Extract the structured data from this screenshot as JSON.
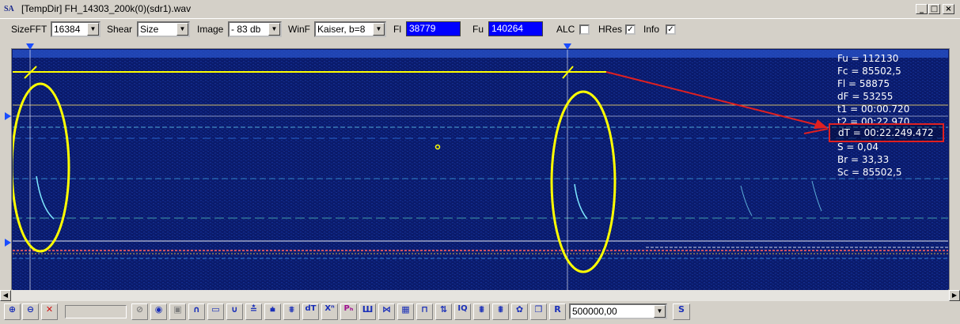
{
  "window": {
    "icon_text": "SA",
    "title": "[TempDir] FH_14303_200k(0)(sdr1).wav",
    "minimize": "_",
    "maximize": "□",
    "close": "×"
  },
  "toolbar": {
    "sizefft_label": "SizeFFT",
    "sizefft_value": "16384",
    "shear_label": "Shear",
    "shear_value": "Size",
    "image_label": "Image",
    "image_value": "- 83 db",
    "winf_label": "WinF",
    "winf_value": "Kaiser, b=8",
    "fl_label": "Fl",
    "fl_value": "38779",
    "fu_label": "Fu",
    "fu_value": "140264",
    "alc_label": "ALC",
    "alc_checked": false,
    "hres_label": "HRes",
    "hres_checked": true,
    "info_label": "Info",
    "info_checked": true
  },
  "info_overlay": {
    "lines": [
      "Fu = 112130",
      "Fc = 85502,5",
      "Fl = 58875",
      "dF = 53255",
      "t1 = 00:00.720",
      "t2 = 00:22.970"
    ],
    "dt": "dT = 00:22.249.472",
    "lines_after": [
      "S = 0,04",
      "Br = 33,33",
      "Sc = 85502,5"
    ]
  },
  "annotation_colors": {
    "cursor_line": "#ffff00",
    "ellipse": "#ffff00",
    "arrow": "#e02020",
    "highlight_box": "#e02020"
  },
  "bottom_toolbar": {
    "buttons": [
      {
        "name": "zoom-in-icon",
        "glyph": "🔍"
      },
      {
        "name": "zoom-out-icon",
        "glyph": "🔍"
      },
      {
        "name": "close-x-icon",
        "glyph": "✕"
      },
      {
        "name": "disabled-icon",
        "glyph": "⊘"
      },
      {
        "name": "speaker-icon",
        "glyph": "◉"
      },
      {
        "name": "square-icon",
        "glyph": "▣"
      },
      {
        "name": "arc-up-icon",
        "glyph": "∩"
      },
      {
        "name": "rectangle-icon",
        "glyph": "▭"
      },
      {
        "name": "arc-down-icon",
        "glyph": "∪"
      },
      {
        "name": "tree-icon",
        "glyph": "≛"
      },
      {
        "name": "marker-down-icon",
        "glyph": "⩧"
      },
      {
        "name": "double-marker-icon",
        "glyph": "⩨"
      },
      {
        "name": "dt-icon",
        "glyph": "dT"
      },
      {
        "name": "xn-icon",
        "glyph": "Xⁿ"
      },
      {
        "name": "ph-icon",
        "glyph": "Pₕ"
      },
      {
        "name": "bars-icon",
        "glyph": "Ш"
      },
      {
        "name": "cross-icon",
        "glyph": "⋈"
      },
      {
        "name": "grid-icon",
        "glyph": "▦"
      },
      {
        "name": "pulse-icon",
        "glyph": "⊓"
      },
      {
        "name": "arrows-icon",
        "glyph": "⇅"
      },
      {
        "name": "iq-icon",
        "glyph": "IQ"
      },
      {
        "name": "pattern1-icon",
        "glyph": "⩩"
      },
      {
        "name": "pattern2-icon",
        "glyph": "⩩"
      },
      {
        "name": "gear-icon",
        "glyph": "✿"
      },
      {
        "name": "copy-icon",
        "glyph": "❐"
      },
      {
        "name": "r-icon",
        "glyph": "R"
      }
    ],
    "rate_value": "500000,00",
    "s_button": "S"
  }
}
